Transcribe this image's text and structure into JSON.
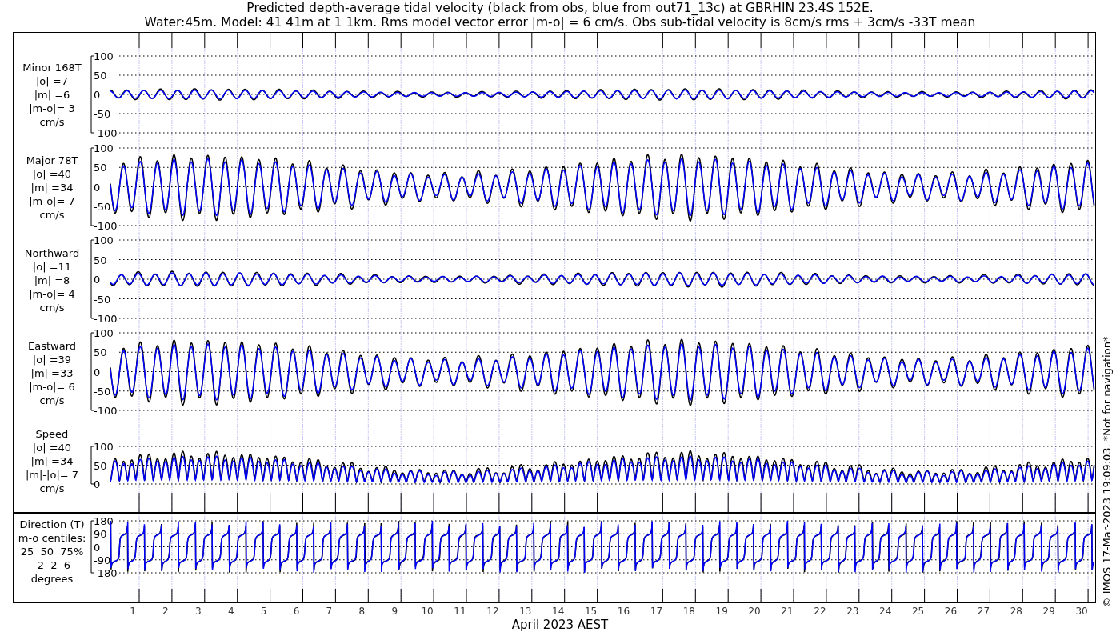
{
  "title_lines": [
    "Predicted depth-average tidal velocity (black from obs, blue from out71_13c) at GBRHIN 23.4S 152E.",
    "Water:45m. Model: 41 41m at 1 1km. Rms model vector error |m-o| = 6 cm/s. Obs sub-tidal velocity is 8cm/s rms + 3cm/s -33T mean"
  ],
  "panels": [
    {
      "kind": "minor",
      "label_lines": [
        "Minor 168T",
        "|o| =7",
        "|m| =6",
        "|m-o|= 3",
        "cm/s"
      ],
      "yticks": [
        "100",
        "50",
        "0",
        "-50",
        "-100"
      ]
    },
    {
      "kind": "major",
      "label_lines": [
        "Major 78T",
        "|o| =40",
        "|m| =34",
        "|m-o|= 7",
        "cm/s"
      ],
      "yticks": [
        "100",
        "50",
        "0",
        "-50",
        "-100"
      ]
    },
    {
      "kind": "north",
      "label_lines": [
        "Northward",
        "|o| =11",
        "|m| =8",
        "|m-o|= 4",
        "cm/s"
      ],
      "yticks": [
        "100",
        "50",
        "0",
        "-50",
        "-100"
      ]
    },
    {
      "kind": "east",
      "label_lines": [
        "Eastward",
        "|o| =39",
        "|m| =33",
        "|m-o|= 6",
        "cm/s"
      ],
      "yticks": [
        "100",
        "50",
        "0",
        "-50",
        "-100"
      ]
    },
    {
      "kind": "speed",
      "label_lines": [
        "Speed",
        "|o| =40",
        "|m| =34",
        "|m|-|o|= 7",
        "cm/s"
      ],
      "yticks": [
        "100",
        "50",
        "0"
      ]
    },
    {
      "kind": "direction",
      "label_lines": [
        "Direction (T)",
        "m-o centiles:",
        "25  50  75%",
        "-2  2  6",
        "degrees"
      ],
      "yticks": [
        "180",
        "90",
        "0",
        "-90",
        "-180"
      ]
    }
  ],
  "x_axis": {
    "days": [
      "1",
      "2",
      "3",
      "4",
      "5",
      "6",
      "7",
      "8",
      "9",
      "10",
      "11",
      "12",
      "13",
      "14",
      "15",
      "16",
      "17",
      "18",
      "19",
      "20",
      "21",
      "22",
      "23",
      "24",
      "25",
      "26",
      "27",
      "28",
      "29",
      "30"
    ],
    "label": "April 2023 AEST"
  },
  "notice": "© IMOS 17-Mar-2023 19:09:03. *Not for navigation*"
}
